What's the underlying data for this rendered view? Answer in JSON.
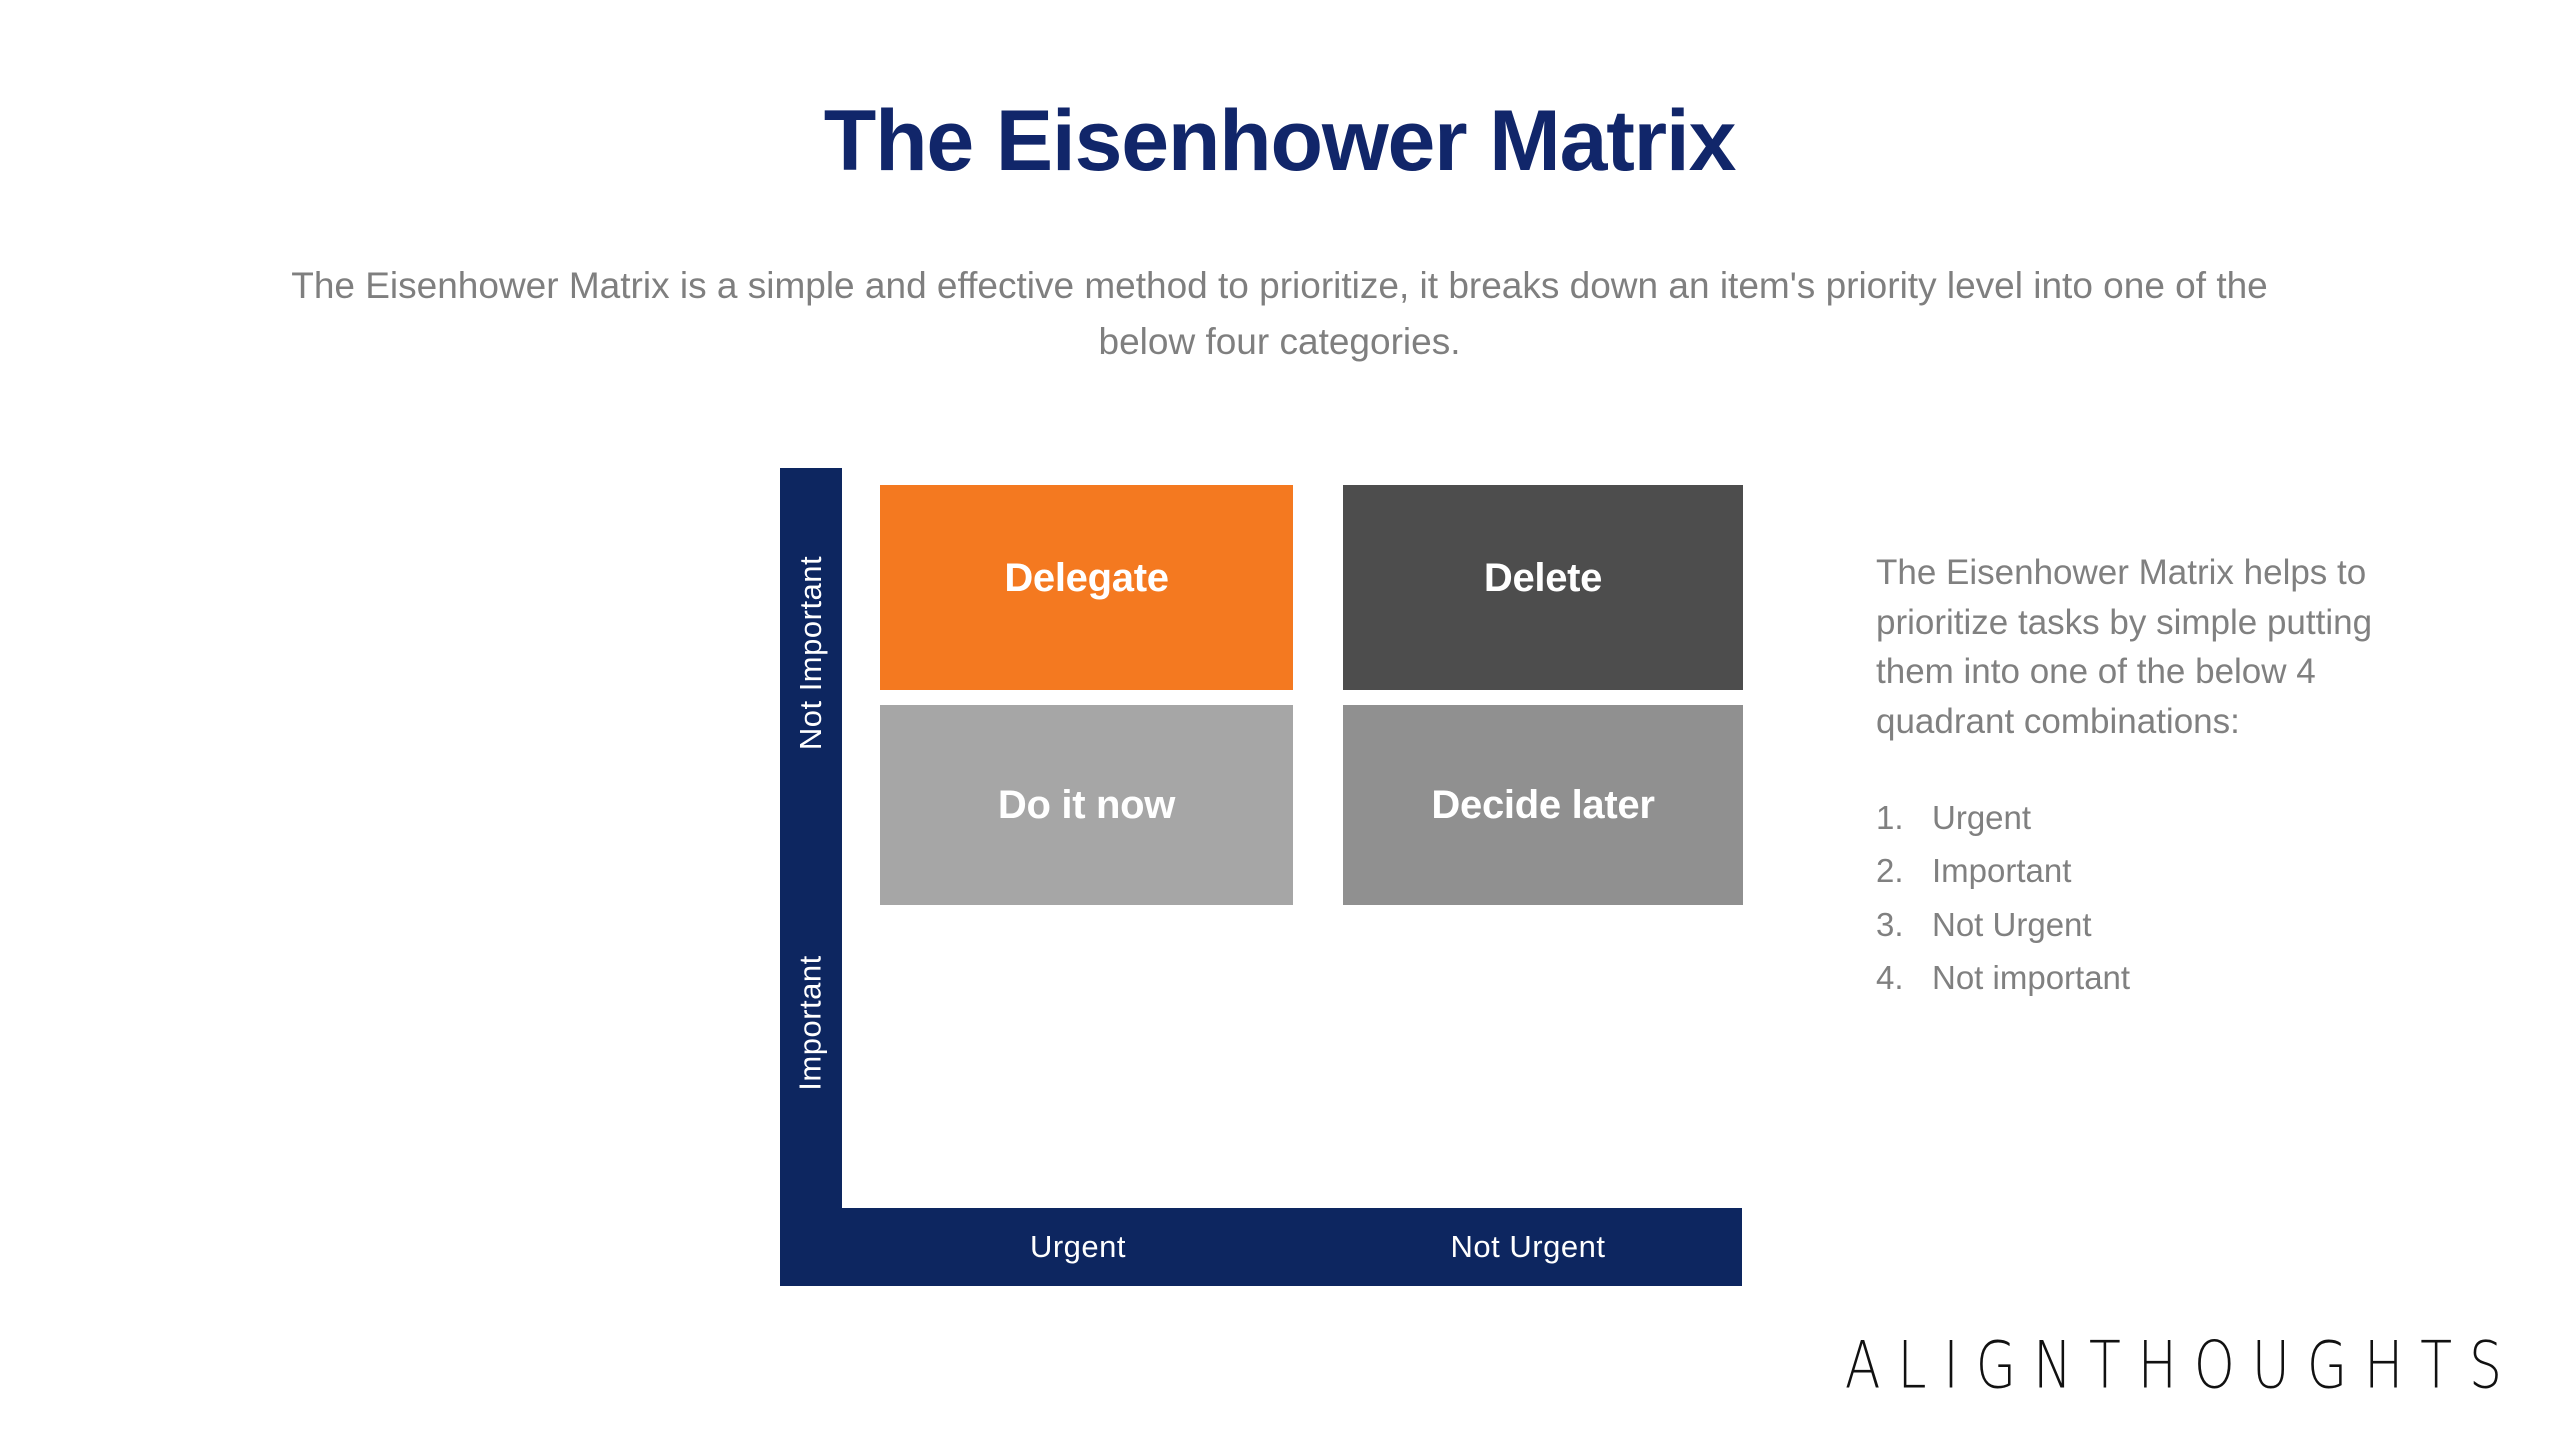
{
  "header": {
    "title": "The Eisenhower Matrix",
    "subtitle": "The Eisenhower Matrix is a simple and effective method to prioritize, it breaks down an item's priority level into one of the below four categories."
  },
  "colors": {
    "navy": "#0D2660",
    "title_navy": "#11266A",
    "orange": "#F47920",
    "dark_gray": "#4D4D4D",
    "light_gray": "#A6A6A6",
    "medium_gray": "#909090",
    "body_gray": "#808080",
    "white": "#FFFFFF"
  },
  "matrix": {
    "y_axis": {
      "top_label": "Not Important",
      "bottom_label": "Important"
    },
    "x_axis": {
      "left_label": "Urgent",
      "right_label": "Not Urgent"
    },
    "quadrants": [
      {
        "id": "delegate",
        "label": "Delegate",
        "color": "#F47920",
        "row": "Not Important",
        "column": "Urgent"
      },
      {
        "id": "delete",
        "label": "Delete",
        "color": "#4D4D4D",
        "row": "Not Important",
        "column": "Not Urgent"
      },
      {
        "id": "do-it-now",
        "label": "Do it now",
        "color": "#A6A6A6",
        "row": "Important",
        "column": "Urgent"
      },
      {
        "id": "decide-later",
        "label": "Decide later",
        "color": "#909090",
        "row": "Important",
        "column": "Not Urgent"
      }
    ]
  },
  "side_panel": {
    "paragraph": "The Eisenhower Matrix helps to prioritize tasks by simple putting them into one of the below 4 quadrant combinations:",
    "list": [
      {
        "num": "1.",
        "label": "Urgent"
      },
      {
        "num": "2.",
        "label": "Important"
      },
      {
        "num": "3.",
        "label": "Not Urgent"
      },
      {
        "num": "4.",
        "label": "Not important"
      }
    ]
  },
  "footer": {
    "brand": "ALIGNTHOUGHTS"
  }
}
